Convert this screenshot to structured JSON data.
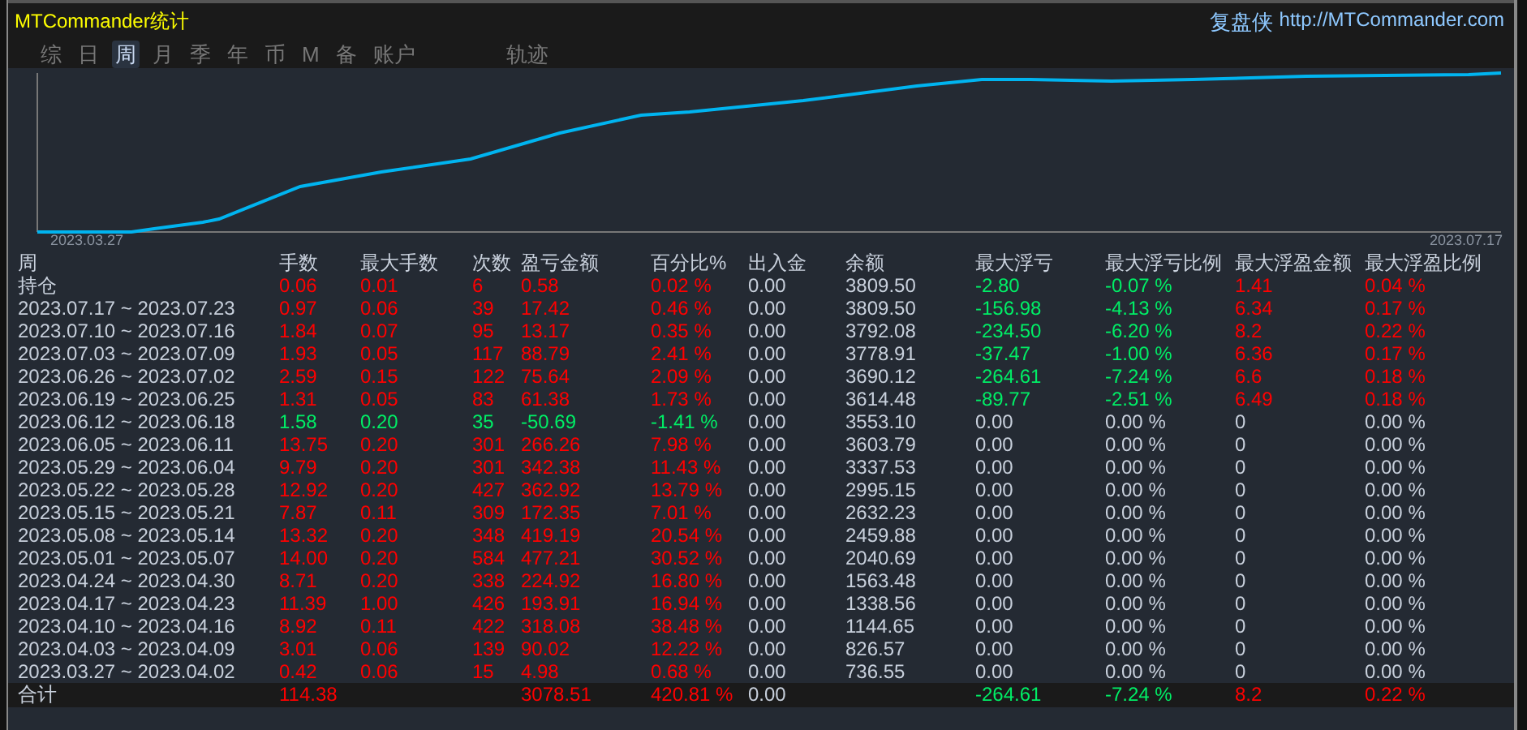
{
  "window": {
    "title": "MTCommander统计",
    "site_name": "复盘侠",
    "site_url": "http://MTCommander.com"
  },
  "tabs": [
    {
      "label": "综",
      "selected": false
    },
    {
      "label": "日",
      "selected": false
    },
    {
      "label": "周",
      "selected": true
    },
    {
      "label": "月",
      "selected": false
    },
    {
      "label": "季",
      "selected": false
    },
    {
      "label": "年",
      "selected": false
    },
    {
      "label": "币",
      "selected": false
    },
    {
      "label": "M",
      "selected": false
    },
    {
      "label": "备",
      "selected": false
    },
    {
      "label": "账户",
      "selected": false
    }
  ],
  "trace_tab": {
    "label": "轨迹",
    "selected": false
  },
  "chart": {
    "start_label": "2023.03.27",
    "end_label": "2023.07.17"
  },
  "table": {
    "columns": [
      "周",
      "手数",
      "最大手数",
      "次数",
      "盈亏金额",
      "百分比%",
      "出入金",
      "余额",
      "最大浮亏",
      "最大浮亏比例",
      "最大浮盈金额",
      "最大浮盈比例"
    ],
    "rows": [
      {
        "cells": [
          {
            "text": "持仓",
            "color": "#c8d0dc"
          },
          {
            "text": "0.06",
            "color": "#ff0000"
          },
          {
            "text": "0.01",
            "color": "#ff0000"
          },
          {
            "text": "6",
            "color": "#ff0000"
          },
          {
            "text": "0.58",
            "color": "#ff0000"
          },
          {
            "text": "0.02 %",
            "color": "#ff0000"
          },
          {
            "text": "0.00",
            "color": "#c8d0dc"
          },
          {
            "text": "3809.50",
            "color": "#c8d0dc"
          },
          {
            "text": "-2.80",
            "color": "#00ee66"
          },
          {
            "text": "-0.07 %",
            "color": "#00ee66"
          },
          {
            "text": "1.41",
            "color": "#ff0000"
          },
          {
            "text": "0.04 %",
            "color": "#ff0000"
          }
        ]
      },
      {
        "cells": [
          {
            "text": "2023.07.17 ~ 2023.07.23",
            "color": "#c8d0dc"
          },
          {
            "text": "0.97",
            "color": "#ff0000"
          },
          {
            "text": "0.06",
            "color": "#ff0000"
          },
          {
            "text": "39",
            "color": "#ff0000"
          },
          {
            "text": "17.42",
            "color": "#ff0000"
          },
          {
            "text": "0.46 %",
            "color": "#ff0000"
          },
          {
            "text": "0.00",
            "color": "#c8d0dc"
          },
          {
            "text": "3809.50",
            "color": "#c8d0dc"
          },
          {
            "text": "-156.98",
            "color": "#00ee66"
          },
          {
            "text": "-4.13 %",
            "color": "#00ee66"
          },
          {
            "text": "6.34",
            "color": "#ff0000"
          },
          {
            "text": "0.17 %",
            "color": "#ff0000"
          }
        ]
      },
      {
        "cells": [
          {
            "text": "2023.07.10 ~ 2023.07.16",
            "color": "#c8d0dc"
          },
          {
            "text": "1.84",
            "color": "#ff0000"
          },
          {
            "text": "0.07",
            "color": "#ff0000"
          },
          {
            "text": "95",
            "color": "#ff0000"
          },
          {
            "text": "13.17",
            "color": "#ff0000"
          },
          {
            "text": "0.35 %",
            "color": "#ff0000"
          },
          {
            "text": "0.00",
            "color": "#c8d0dc"
          },
          {
            "text": "3792.08",
            "color": "#c8d0dc"
          },
          {
            "text": "-234.50",
            "color": "#00ee66"
          },
          {
            "text": "-6.20 %",
            "color": "#00ee66"
          },
          {
            "text": "8.2",
            "color": "#ff0000"
          },
          {
            "text": "0.22 %",
            "color": "#ff0000"
          }
        ]
      },
      {
        "cells": [
          {
            "text": "2023.07.03 ~ 2023.07.09",
            "color": "#c8d0dc"
          },
          {
            "text": "1.93",
            "color": "#ff0000"
          },
          {
            "text": "0.05",
            "color": "#ff0000"
          },
          {
            "text": "117",
            "color": "#ff0000"
          },
          {
            "text": "88.79",
            "color": "#ff0000"
          },
          {
            "text": "2.41 %",
            "color": "#ff0000"
          },
          {
            "text": "0.00",
            "color": "#c8d0dc"
          },
          {
            "text": "3778.91",
            "color": "#c8d0dc"
          },
          {
            "text": "-37.47",
            "color": "#00ee66"
          },
          {
            "text": "-1.00 %",
            "color": "#00ee66"
          },
          {
            "text": "6.36",
            "color": "#ff0000"
          },
          {
            "text": "0.17 %",
            "color": "#ff0000"
          }
        ]
      },
      {
        "cells": [
          {
            "text": "2023.06.26 ~ 2023.07.02",
            "color": "#c8d0dc"
          },
          {
            "text": "2.59",
            "color": "#ff0000"
          },
          {
            "text": "0.15",
            "color": "#ff0000"
          },
          {
            "text": "122",
            "color": "#ff0000"
          },
          {
            "text": "75.64",
            "color": "#ff0000"
          },
          {
            "text": "2.09 %",
            "color": "#ff0000"
          },
          {
            "text": "0.00",
            "color": "#c8d0dc"
          },
          {
            "text": "3690.12",
            "color": "#c8d0dc"
          },
          {
            "text": "-264.61",
            "color": "#00ee66"
          },
          {
            "text": "-7.24 %",
            "color": "#00ee66"
          },
          {
            "text": "6.6",
            "color": "#ff0000"
          },
          {
            "text": "0.18 %",
            "color": "#ff0000"
          }
        ]
      },
      {
        "cells": [
          {
            "text": "2023.06.19 ~ 2023.06.25",
            "color": "#c8d0dc"
          },
          {
            "text": "1.31",
            "color": "#ff0000"
          },
          {
            "text": "0.05",
            "color": "#ff0000"
          },
          {
            "text": "83",
            "color": "#ff0000"
          },
          {
            "text": "61.38",
            "color": "#ff0000"
          },
          {
            "text": "1.73 %",
            "color": "#ff0000"
          },
          {
            "text": "0.00",
            "color": "#c8d0dc"
          },
          {
            "text": "3614.48",
            "color": "#c8d0dc"
          },
          {
            "text": "-89.77",
            "color": "#00ee66"
          },
          {
            "text": "-2.51 %",
            "color": "#00ee66"
          },
          {
            "text": "6.49",
            "color": "#ff0000"
          },
          {
            "text": "0.18 %",
            "color": "#ff0000"
          }
        ]
      },
      {
        "cells": [
          {
            "text": "2023.06.12 ~ 2023.06.18",
            "color": "#c8d0dc"
          },
          {
            "text": "1.58",
            "color": "#00ee66"
          },
          {
            "text": "0.20",
            "color": "#00ee66"
          },
          {
            "text": "35",
            "color": "#00ee66"
          },
          {
            "text": "-50.69",
            "color": "#00ee66"
          },
          {
            "text": "-1.41 %",
            "color": "#00ee66"
          },
          {
            "text": "0.00",
            "color": "#c8d0dc"
          },
          {
            "text": "3553.10",
            "color": "#c8d0dc"
          },
          {
            "text": "0.00",
            "color": "#c8d0dc"
          },
          {
            "text": "0.00 %",
            "color": "#c8d0dc"
          },
          {
            "text": "0",
            "color": "#c8d0dc"
          },
          {
            "text": "0.00 %",
            "color": "#c8d0dc"
          }
        ]
      },
      {
        "cells": [
          {
            "text": "2023.06.05 ~ 2023.06.11",
            "color": "#c8d0dc"
          },
          {
            "text": "13.75",
            "color": "#ff0000"
          },
          {
            "text": "0.20",
            "color": "#ff0000"
          },
          {
            "text": "301",
            "color": "#ff0000"
          },
          {
            "text": "266.26",
            "color": "#ff0000"
          },
          {
            "text": "7.98 %",
            "color": "#ff0000"
          },
          {
            "text": "0.00",
            "color": "#c8d0dc"
          },
          {
            "text": "3603.79",
            "color": "#c8d0dc"
          },
          {
            "text": "0.00",
            "color": "#c8d0dc"
          },
          {
            "text": "0.00 %",
            "color": "#c8d0dc"
          },
          {
            "text": "0",
            "color": "#c8d0dc"
          },
          {
            "text": "0.00 %",
            "color": "#c8d0dc"
          }
        ]
      },
      {
        "cells": [
          {
            "text": "2023.05.29 ~ 2023.06.04",
            "color": "#c8d0dc"
          },
          {
            "text": "9.79",
            "color": "#ff0000"
          },
          {
            "text": "0.20",
            "color": "#ff0000"
          },
          {
            "text": "301",
            "color": "#ff0000"
          },
          {
            "text": "342.38",
            "color": "#ff0000"
          },
          {
            "text": "11.43 %",
            "color": "#ff0000"
          },
          {
            "text": "0.00",
            "color": "#c8d0dc"
          },
          {
            "text": "3337.53",
            "color": "#c8d0dc"
          },
          {
            "text": "0.00",
            "color": "#c8d0dc"
          },
          {
            "text": "0.00 %",
            "color": "#c8d0dc"
          },
          {
            "text": "0",
            "color": "#c8d0dc"
          },
          {
            "text": "0.00 %",
            "color": "#c8d0dc"
          }
        ]
      },
      {
        "cells": [
          {
            "text": "2023.05.22 ~ 2023.05.28",
            "color": "#c8d0dc"
          },
          {
            "text": "12.92",
            "color": "#ff0000"
          },
          {
            "text": "0.20",
            "color": "#ff0000"
          },
          {
            "text": "427",
            "color": "#ff0000"
          },
          {
            "text": "362.92",
            "color": "#ff0000"
          },
          {
            "text": "13.79 %",
            "color": "#ff0000"
          },
          {
            "text": "0.00",
            "color": "#c8d0dc"
          },
          {
            "text": "2995.15",
            "color": "#c8d0dc"
          },
          {
            "text": "0.00",
            "color": "#c8d0dc"
          },
          {
            "text": "0.00 %",
            "color": "#c8d0dc"
          },
          {
            "text": "0",
            "color": "#c8d0dc"
          },
          {
            "text": "0.00 %",
            "color": "#c8d0dc"
          }
        ]
      },
      {
        "cells": [
          {
            "text": "2023.05.15 ~ 2023.05.21",
            "color": "#c8d0dc"
          },
          {
            "text": "7.87",
            "color": "#ff0000"
          },
          {
            "text": "0.11",
            "color": "#ff0000"
          },
          {
            "text": "309",
            "color": "#ff0000"
          },
          {
            "text": "172.35",
            "color": "#ff0000"
          },
          {
            "text": "7.01 %",
            "color": "#ff0000"
          },
          {
            "text": "0.00",
            "color": "#c8d0dc"
          },
          {
            "text": "2632.23",
            "color": "#c8d0dc"
          },
          {
            "text": "0.00",
            "color": "#c8d0dc"
          },
          {
            "text": "0.00 %",
            "color": "#c8d0dc"
          },
          {
            "text": "0",
            "color": "#c8d0dc"
          },
          {
            "text": "0.00 %",
            "color": "#c8d0dc"
          }
        ]
      },
      {
        "cells": [
          {
            "text": "2023.05.08 ~ 2023.05.14",
            "color": "#c8d0dc"
          },
          {
            "text": "13.32",
            "color": "#ff0000"
          },
          {
            "text": "0.20",
            "color": "#ff0000"
          },
          {
            "text": "348",
            "color": "#ff0000"
          },
          {
            "text": "419.19",
            "color": "#ff0000"
          },
          {
            "text": "20.54 %",
            "color": "#ff0000"
          },
          {
            "text": "0.00",
            "color": "#c8d0dc"
          },
          {
            "text": "2459.88",
            "color": "#c8d0dc"
          },
          {
            "text": "0.00",
            "color": "#c8d0dc"
          },
          {
            "text": "0.00 %",
            "color": "#c8d0dc"
          },
          {
            "text": "0",
            "color": "#c8d0dc"
          },
          {
            "text": "0.00 %",
            "color": "#c8d0dc"
          }
        ]
      },
      {
        "cells": [
          {
            "text": "2023.05.01 ~ 2023.05.07",
            "color": "#c8d0dc"
          },
          {
            "text": "14.00",
            "color": "#ff0000"
          },
          {
            "text": "0.20",
            "color": "#ff0000"
          },
          {
            "text": "584",
            "color": "#ff0000"
          },
          {
            "text": "477.21",
            "color": "#ff0000"
          },
          {
            "text": "30.52 %",
            "color": "#ff0000"
          },
          {
            "text": "0.00",
            "color": "#c8d0dc"
          },
          {
            "text": "2040.69",
            "color": "#c8d0dc"
          },
          {
            "text": "0.00",
            "color": "#c8d0dc"
          },
          {
            "text": "0.00 %",
            "color": "#c8d0dc"
          },
          {
            "text": "0",
            "color": "#c8d0dc"
          },
          {
            "text": "0.00 %",
            "color": "#c8d0dc"
          }
        ]
      },
      {
        "cells": [
          {
            "text": "2023.04.24 ~ 2023.04.30",
            "color": "#c8d0dc"
          },
          {
            "text": "8.71",
            "color": "#ff0000"
          },
          {
            "text": "0.20",
            "color": "#ff0000"
          },
          {
            "text": "338",
            "color": "#ff0000"
          },
          {
            "text": "224.92",
            "color": "#ff0000"
          },
          {
            "text": "16.80 %",
            "color": "#ff0000"
          },
          {
            "text": "0.00",
            "color": "#c8d0dc"
          },
          {
            "text": "1563.48",
            "color": "#c8d0dc"
          },
          {
            "text": "0.00",
            "color": "#c8d0dc"
          },
          {
            "text": "0.00 %",
            "color": "#c8d0dc"
          },
          {
            "text": "0",
            "color": "#c8d0dc"
          },
          {
            "text": "0.00 %",
            "color": "#c8d0dc"
          }
        ]
      },
      {
        "cells": [
          {
            "text": "2023.04.17 ~ 2023.04.23",
            "color": "#c8d0dc"
          },
          {
            "text": "11.39",
            "color": "#ff0000"
          },
          {
            "text": "1.00",
            "color": "#ff0000"
          },
          {
            "text": "426",
            "color": "#ff0000"
          },
          {
            "text": "193.91",
            "color": "#ff0000"
          },
          {
            "text": "16.94 %",
            "color": "#ff0000"
          },
          {
            "text": "0.00",
            "color": "#c8d0dc"
          },
          {
            "text": "1338.56",
            "color": "#c8d0dc"
          },
          {
            "text": "0.00",
            "color": "#c8d0dc"
          },
          {
            "text": "0.00 %",
            "color": "#c8d0dc"
          },
          {
            "text": "0",
            "color": "#c8d0dc"
          },
          {
            "text": "0.00 %",
            "color": "#c8d0dc"
          }
        ]
      },
      {
        "cells": [
          {
            "text": "2023.04.10 ~ 2023.04.16",
            "color": "#c8d0dc"
          },
          {
            "text": "8.92",
            "color": "#ff0000"
          },
          {
            "text": "0.11",
            "color": "#ff0000"
          },
          {
            "text": "422",
            "color": "#ff0000"
          },
          {
            "text": "318.08",
            "color": "#ff0000"
          },
          {
            "text": "38.48 %",
            "color": "#ff0000"
          },
          {
            "text": "0.00",
            "color": "#c8d0dc"
          },
          {
            "text": "1144.65",
            "color": "#c8d0dc"
          },
          {
            "text": "0.00",
            "color": "#c8d0dc"
          },
          {
            "text": "0.00 %",
            "color": "#c8d0dc"
          },
          {
            "text": "0",
            "color": "#c8d0dc"
          },
          {
            "text": "0.00 %",
            "color": "#c8d0dc"
          }
        ]
      },
      {
        "cells": [
          {
            "text": "2023.04.03 ~ 2023.04.09",
            "color": "#c8d0dc"
          },
          {
            "text": "3.01",
            "color": "#ff0000"
          },
          {
            "text": "0.06",
            "color": "#ff0000"
          },
          {
            "text": "139",
            "color": "#ff0000"
          },
          {
            "text": "90.02",
            "color": "#ff0000"
          },
          {
            "text": "12.22 %",
            "color": "#ff0000"
          },
          {
            "text": "0.00",
            "color": "#c8d0dc"
          },
          {
            "text": "826.57",
            "color": "#c8d0dc"
          },
          {
            "text": "0.00",
            "color": "#c8d0dc"
          },
          {
            "text": "0.00 %",
            "color": "#c8d0dc"
          },
          {
            "text": "0",
            "color": "#c8d0dc"
          },
          {
            "text": "0.00 %",
            "color": "#c8d0dc"
          }
        ]
      },
      {
        "cells": [
          {
            "text": "2023.03.27 ~ 2023.04.02",
            "color": "#c8d0dc"
          },
          {
            "text": "0.42",
            "color": "#ff0000"
          },
          {
            "text": "0.06",
            "color": "#ff0000"
          },
          {
            "text": "15",
            "color": "#ff0000"
          },
          {
            "text": "4.98",
            "color": "#ff0000"
          },
          {
            "text": "0.68 %",
            "color": "#ff0000"
          },
          {
            "text": "0.00",
            "color": "#c8d0dc"
          },
          {
            "text": "736.55",
            "color": "#c8d0dc"
          },
          {
            "text": "0.00",
            "color": "#c8d0dc"
          },
          {
            "text": "0.00 %",
            "color": "#c8d0dc"
          },
          {
            "text": "0",
            "color": "#c8d0dc"
          },
          {
            "text": "0.00 %",
            "color": "#c8d0dc"
          }
        ]
      }
    ],
    "total": {
      "cells": [
        {
          "text": "合计",
          "color": "#c8d0dc"
        },
        {
          "text": "114.38",
          "color": "#ff0000"
        },
        null,
        null,
        {
          "text": "3078.51",
          "color": "#ff0000"
        },
        {
          "text": "420.81 %",
          "color": "#ff0000"
        },
        {
          "text": "0.00",
          "color": "#c8d0dc"
        },
        null,
        {
          "text": "-264.61",
          "color": "#00ee66"
        },
        {
          "text": "-7.24 %",
          "color": "#00ee66"
        },
        {
          "text": "8.2",
          "color": "#ff0000"
        },
        {
          "text": "0.22 %",
          "color": "#ff0000"
        }
      ]
    }
  }
}
